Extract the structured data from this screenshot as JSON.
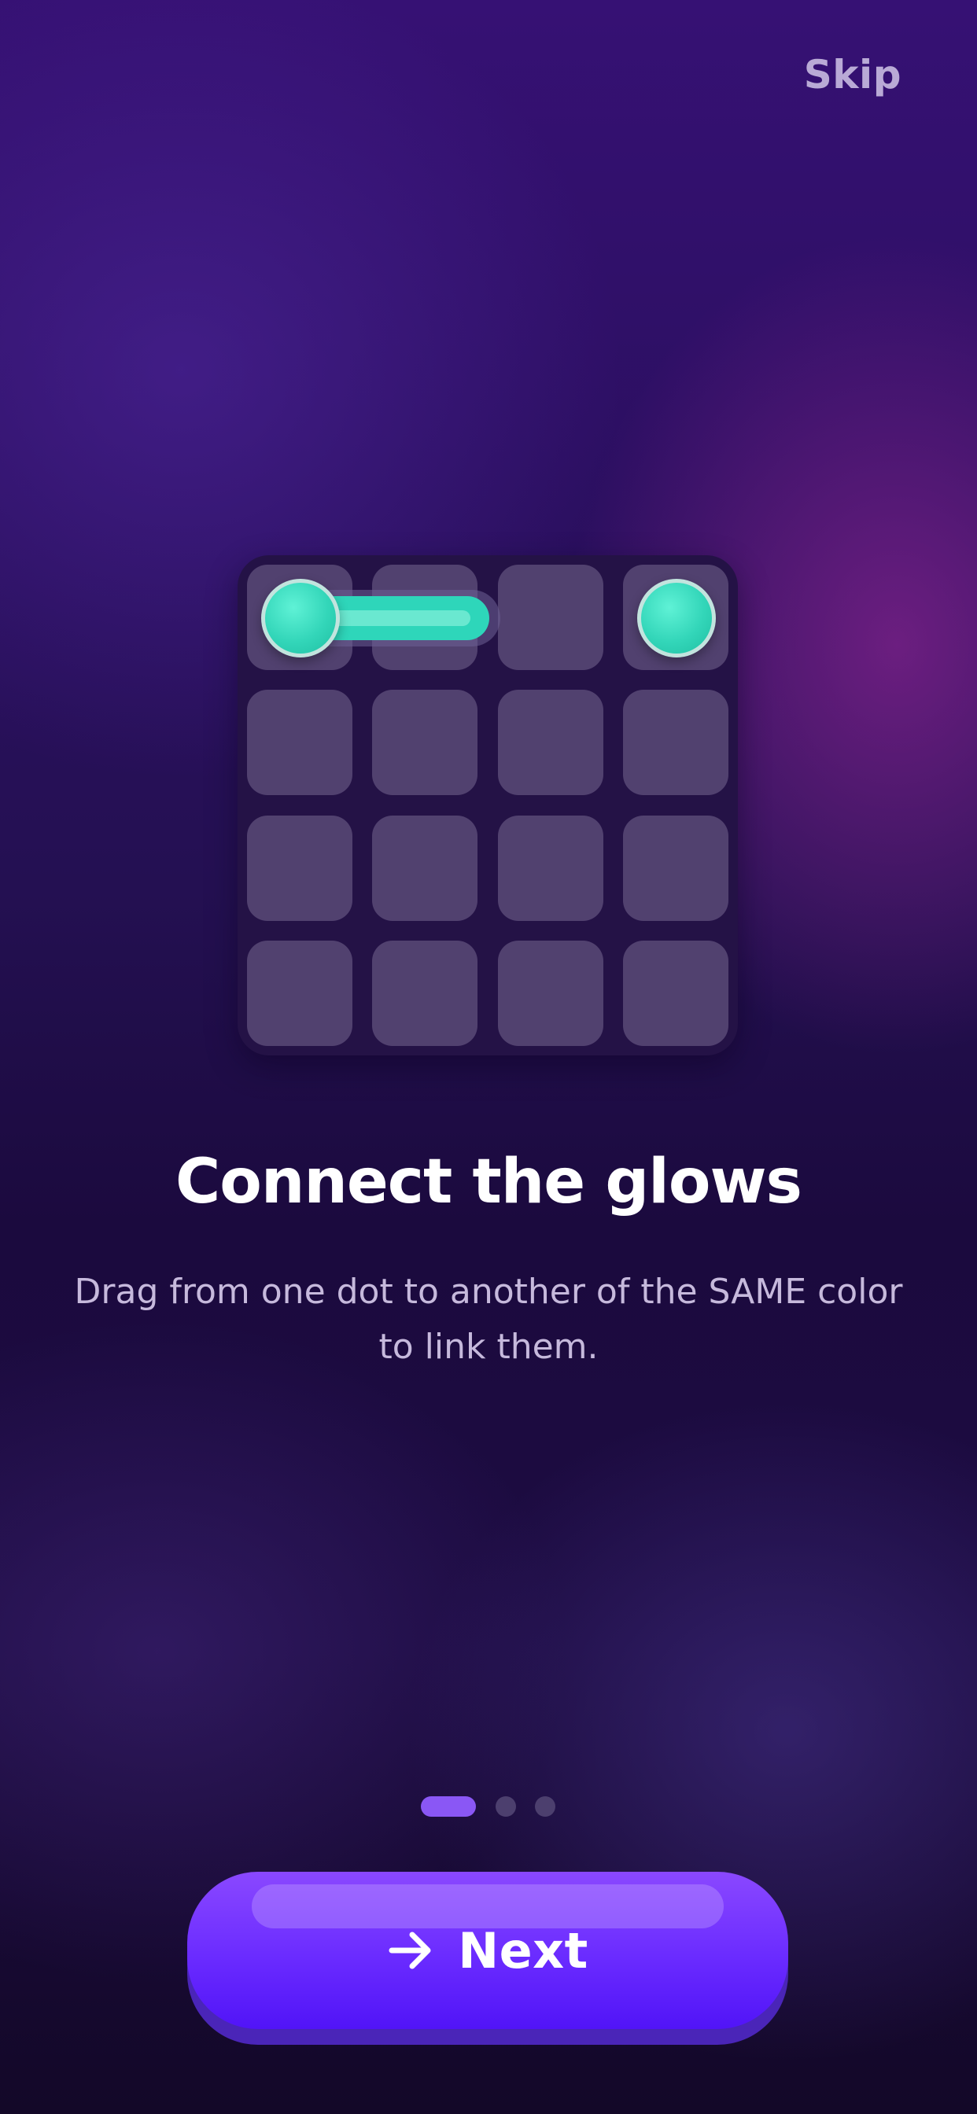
{
  "header": {
    "skip_label": "Skip"
  },
  "illustration": {
    "grid_rows": 4,
    "grid_cols": 4,
    "dot_color": "#33d6b9",
    "cell_color": "#51416f",
    "board_color": "#241246"
  },
  "onboarding": {
    "title": "Connect the glows",
    "description": "Drag from one dot to another of the SAME color to link them."
  },
  "pagination": {
    "total_pages": 3,
    "current_page": 1
  },
  "footer": {
    "next_label": "Next",
    "next_icon": "arrow-right-icon",
    "accent_color": "#6a2bff"
  }
}
